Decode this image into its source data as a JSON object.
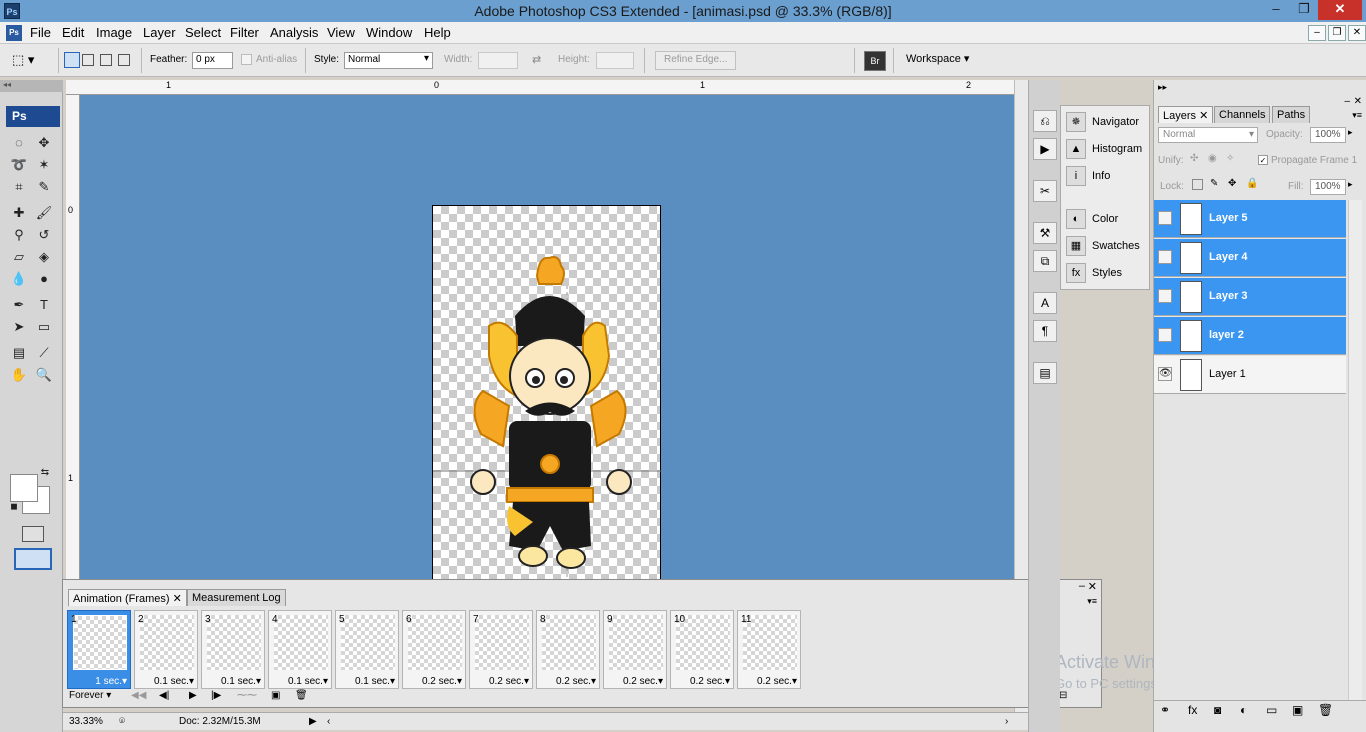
{
  "window": {
    "title": "Adobe Photoshop CS3 Extended - [animasi.psd @ 33.3% (RGB/8)]",
    "app_logo": "Ps",
    "controls": {
      "minimize": "–",
      "maximize": "❐",
      "close": "✕"
    }
  },
  "menu": [
    "File",
    "Edit",
    "Image",
    "Layer",
    "Select",
    "Filter",
    "Analysis",
    "View",
    "Window",
    "Help"
  ],
  "options": {
    "feather_label": "Feather:",
    "feather_value": "0 px",
    "antialias_label": "Anti-alias",
    "style_label": "Style:",
    "style_value": "Normal",
    "width_label": "Width:",
    "height_label": "Height:",
    "refine_edge": "Refine Edge...",
    "workspace": "Workspace"
  },
  "toolbox": {
    "logo": "Ps"
  },
  "rulers": {
    "top": [
      "1",
      "0",
      "1",
      "2"
    ],
    "left": [
      "0",
      "1"
    ]
  },
  "status": {
    "zoom": "33.33%",
    "doc": "Doc: 2.32M/15.3M"
  },
  "animation": {
    "tabs": [
      "Animation (Frames)",
      "Measurement Log"
    ],
    "frames": [
      {
        "num": "1",
        "delay": "1 sec."
      },
      {
        "num": "2",
        "delay": "0.1 sec."
      },
      {
        "num": "3",
        "delay": "0.1 sec."
      },
      {
        "num": "4",
        "delay": "0.1 sec."
      },
      {
        "num": "5",
        "delay": "0.1 sec."
      },
      {
        "num": "6",
        "delay": "0.2 sec."
      },
      {
        "num": "7",
        "delay": "0.2 sec."
      },
      {
        "num": "8",
        "delay": "0.2 sec."
      },
      {
        "num": "9",
        "delay": "0.2 sec."
      },
      {
        "num": "10",
        "delay": "0.2 sec."
      },
      {
        "num": "11",
        "delay": "0.2 sec."
      }
    ],
    "loop": "Forever"
  },
  "watermark": {
    "line1": "Activate Windows",
    "line2": "Go to PC settings to activate Windows."
  },
  "dock": {
    "items": [
      "Navigator",
      "Histogram",
      "Info",
      "Color",
      "Swatches",
      "Styles"
    ]
  },
  "layers_panel": {
    "tabs": [
      "Layers",
      "Channels",
      "Paths"
    ],
    "blend_mode": "Normal",
    "opacity_label": "Opacity:",
    "opacity_value": "100%",
    "unify_label": "Unify:",
    "propagate_label": "Propagate Frame 1",
    "lock_label": "Lock:",
    "fill_label": "Fill:",
    "fill_value": "100%",
    "layers": [
      {
        "name": "Layer 5",
        "visible": false,
        "selected": true
      },
      {
        "name": "Layer 4",
        "visible": false,
        "selected": true
      },
      {
        "name": "Layer 3",
        "visible": false,
        "selected": true
      },
      {
        "name": "layer 2",
        "visible": false,
        "selected": true
      },
      {
        "name": "Layer 1",
        "visible": true,
        "selected": false
      }
    ]
  },
  "colors": {
    "selection_blue": "#3a96f0",
    "canvas_bg": "#5b8ec0",
    "title_blue": "#6a9fd0"
  }
}
